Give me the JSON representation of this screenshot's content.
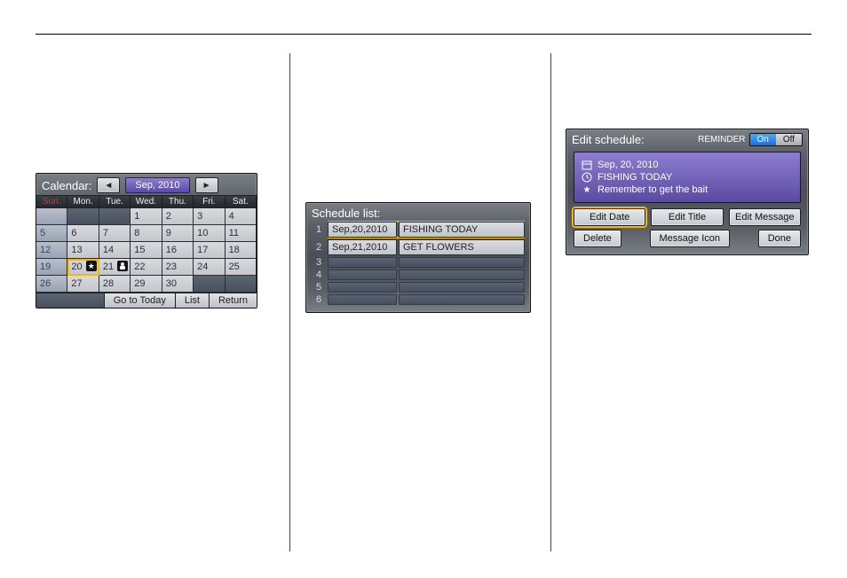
{
  "calendar": {
    "title": "Calendar:",
    "month_label": "Sep, 2010",
    "dow": [
      "Sun.",
      "Mon.",
      "Tue.",
      "Wed.",
      "Thu.",
      "Fri.",
      "Sat."
    ],
    "cells": [
      {
        "n": "",
        "cls": "empty sun"
      },
      {
        "n": "",
        "cls": "empty"
      },
      {
        "n": "",
        "cls": "empty"
      },
      {
        "n": "1"
      },
      {
        "n": "2"
      },
      {
        "n": "3"
      },
      {
        "n": "4"
      },
      {
        "n": "5",
        "cls": "sun"
      },
      {
        "n": "6"
      },
      {
        "n": "7"
      },
      {
        "n": "8"
      },
      {
        "n": "9"
      },
      {
        "n": "10"
      },
      {
        "n": "11"
      },
      {
        "n": "12",
        "cls": "sun"
      },
      {
        "n": "13"
      },
      {
        "n": "14"
      },
      {
        "n": "15"
      },
      {
        "n": "16"
      },
      {
        "n": "17"
      },
      {
        "n": "18"
      },
      {
        "n": "19",
        "cls": "sun"
      },
      {
        "n": "20",
        "cls": "selected",
        "mark": "star"
      },
      {
        "n": "21",
        "mark": "person"
      },
      {
        "n": "22"
      },
      {
        "n": "23"
      },
      {
        "n": "24"
      },
      {
        "n": "25"
      },
      {
        "n": "26",
        "cls": "sun"
      },
      {
        "n": "27"
      },
      {
        "n": "28"
      },
      {
        "n": "29"
      },
      {
        "n": "30"
      },
      {
        "n": "",
        "cls": "empty"
      },
      {
        "n": "",
        "cls": "empty"
      }
    ],
    "footer": {
      "go_today": "Go to Today",
      "list": "List",
      "return": "Return"
    }
  },
  "schedule_list": {
    "title": "Schedule list:",
    "rows": [
      {
        "num": "1",
        "date": "Sep,20,2010",
        "task": "FISHING TODAY",
        "selected": true
      },
      {
        "num": "2",
        "date": "Sep,21,2010",
        "task": "GET FLOWERS"
      },
      {
        "num": "3",
        "date": "",
        "task": "",
        "empty": true
      },
      {
        "num": "4",
        "date": "",
        "task": "",
        "empty": true
      },
      {
        "num": "5",
        "date": "",
        "task": "",
        "empty": true
      },
      {
        "num": "6",
        "date": "",
        "task": "",
        "empty": true
      }
    ]
  },
  "edit_schedule": {
    "title": "Edit schedule:",
    "reminder_label": "REMINDER",
    "reminder_on": "On",
    "reminder_off": "Off",
    "date": "Sep, 20, 2010",
    "task_title": "FISHING TODAY",
    "message": "Remember to get the bait",
    "btn_edit_date": "Edit Date",
    "btn_edit_title": "Edit Title",
    "btn_edit_message": "Edit Message",
    "btn_delete": "Delete",
    "btn_message_icon": "Message Icon",
    "btn_done": "Done"
  }
}
